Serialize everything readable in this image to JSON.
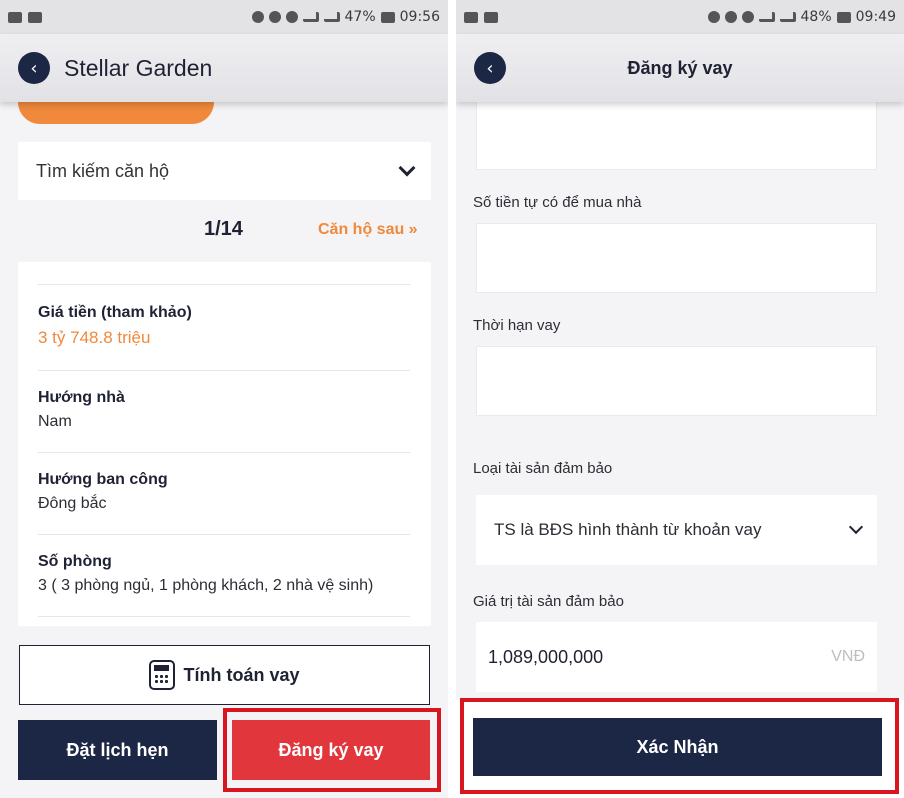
{
  "left": {
    "status": {
      "battery": "47%",
      "time": "09:56"
    },
    "header_title": "Stellar Garden",
    "search_placeholder": "Tìm kiếm căn hộ",
    "pager": {
      "count": "1/14",
      "next_label": "Căn hộ sau »"
    },
    "details": [
      {
        "label": "Giá tiền (tham khảo)",
        "value": "3 tỷ 748.8 triệu"
      },
      {
        "label": "Hướng nhà",
        "value": "Nam"
      },
      {
        "label": "Hướng ban công",
        "value": "Đông bắc"
      },
      {
        "label": "Số phòng",
        "value": "3 ( 3 phòng ngủ, 1 phòng khách, 2 nhà vệ sinh)"
      }
    ],
    "calc_button_label": "Tính toán vay",
    "schedule_button_label": "Đặt lịch hẹn",
    "register_button_label": "Đăng ký vay"
  },
  "right": {
    "status": {
      "battery": "48%",
      "time": "09:49"
    },
    "header_title": "Đăng ký vay",
    "fields": {
      "own_money_label": "Số tiền tự có để mua nhà",
      "loan_term_label": "Thời hạn vay",
      "collateral_type_label": "Loại tài sản đảm bảo",
      "collateral_type_value": "TS là BĐS hình thành từ khoản vay",
      "collateral_value_label": "Giá trị tài sản đảm bảo",
      "collateral_value": "1,089,000,000",
      "collateral_value_unit": "VNĐ"
    },
    "confirm_button_label": "Xác Nhận"
  },
  "colors": {
    "navy": "#1c2645",
    "orange": "#f0893b",
    "red": "#e0363c",
    "highlight": "#d8161f"
  },
  "icons": [
    "back-arrow-icon",
    "chevron-down-icon",
    "calculator-icon",
    "double-chevron-right-icon"
  ]
}
